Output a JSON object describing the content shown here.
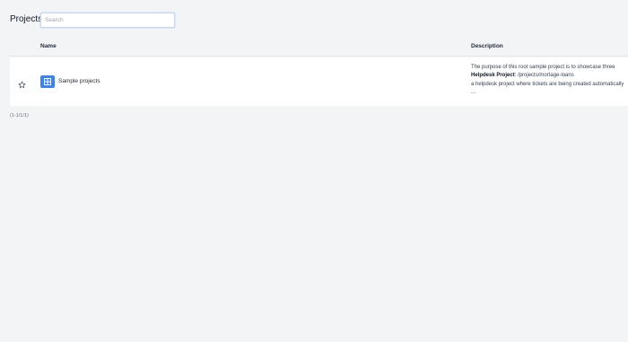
{
  "page": {
    "title": "Projects"
  },
  "search": {
    "placeholder": "Search",
    "value": ""
  },
  "table": {
    "columns": {
      "name": "Name",
      "description": "Description"
    },
    "rows": [
      {
        "favorite_icon": "star-outline-icon",
        "icon": "grid-icon",
        "icon_color": "#3b82f6",
        "name": "Sample projects",
        "description_lines": [
          {
            "text": "The purpose of this root sample project is to showcase three"
          },
          {
            "bold": "Helpdesk Project",
            "text": ": /projects/mortage-loans"
          },
          {
            "text": "a helpdesk project where tickets are being created automatically"
          },
          {
            "text": "..."
          }
        ]
      }
    ]
  },
  "pagination": {
    "text": "(1-1/1/1)"
  }
}
